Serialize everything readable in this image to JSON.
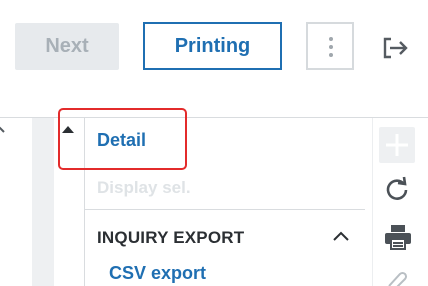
{
  "toolbar": {
    "next_label": "Next",
    "printing_label": "Printing",
    "more_icon": "vertical-dots-icon",
    "logout_icon": "logout-icon"
  },
  "menu": {
    "detail_label": "Detail",
    "display_sel_label": "Display sel.",
    "section_title": "INQUIRY EXPORT",
    "csv_export_label": "CSV export"
  },
  "side_icons": [
    "add-icon",
    "refresh-icon",
    "print-icon",
    "attachment-icon"
  ],
  "colors": {
    "accent": "#1f6fb2",
    "highlight": "#e32b2b",
    "disabled_text": "#a8b0b7"
  }
}
